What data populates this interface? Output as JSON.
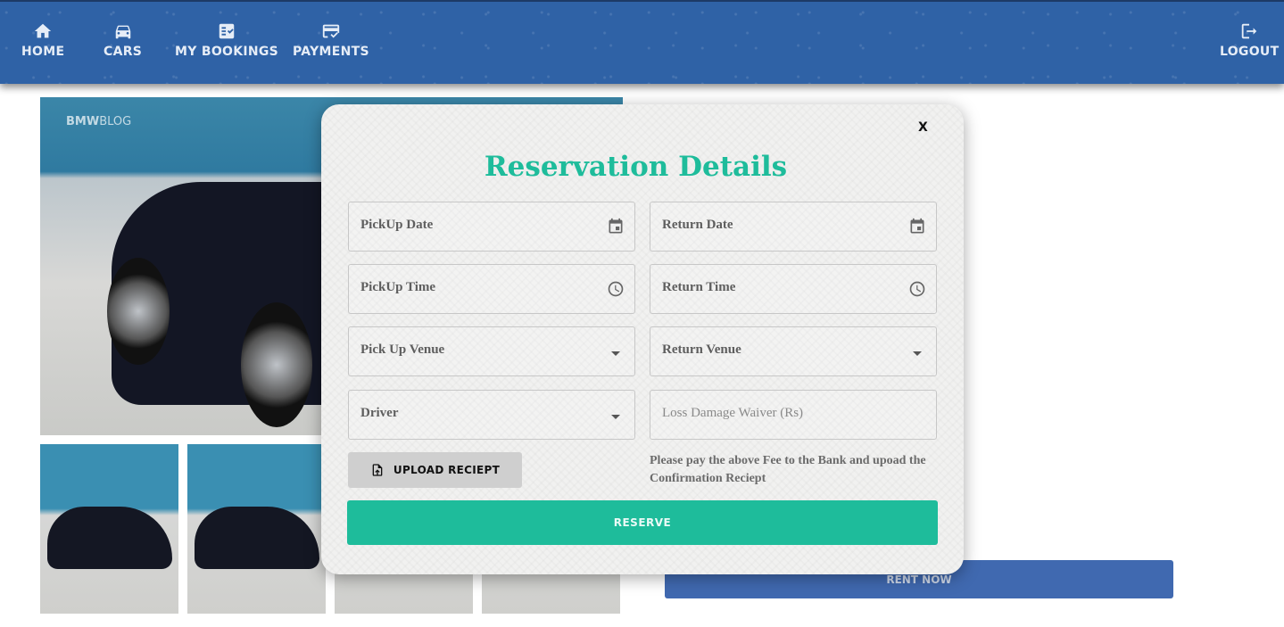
{
  "nav": {
    "home": {
      "label": "HOME",
      "icon": "home-icon"
    },
    "cars": {
      "label": "CARS",
      "icon": "car-icon"
    },
    "bookings": {
      "label": "MY BOOKINGS",
      "icon": "bookings-icon"
    },
    "payments": {
      "label": "PAYMENTS",
      "icon": "payments-icon"
    },
    "logout": {
      "label": "LOGOUT",
      "icon": "logout-icon"
    }
  },
  "gallery": {
    "watermark_bold": "BMW",
    "watermark_light": "BLOG"
  },
  "rent_button": "RENT NOW",
  "modal": {
    "close": "X",
    "title": "Reservation Details",
    "pickup_date": "PickUp Date",
    "return_date": "Return Date",
    "pickup_time": "PickUp Time",
    "return_time": "Return Time",
    "pickup_venue": "Pick Up Venue",
    "return_venue": "Return Venue",
    "driver": "Driver",
    "ldw_placeholder": "Loss Damage Waiver (Rs)",
    "upload": "UPLOAD RECIEPT",
    "note": "Please pay the above Fee to the Bank and upoad the Confirmation Reciept",
    "reserve": "RESERVE"
  },
  "colors": {
    "navbar": "#2f62a6",
    "accent": "#1ebc9b",
    "rent_button": "#4069b0"
  }
}
